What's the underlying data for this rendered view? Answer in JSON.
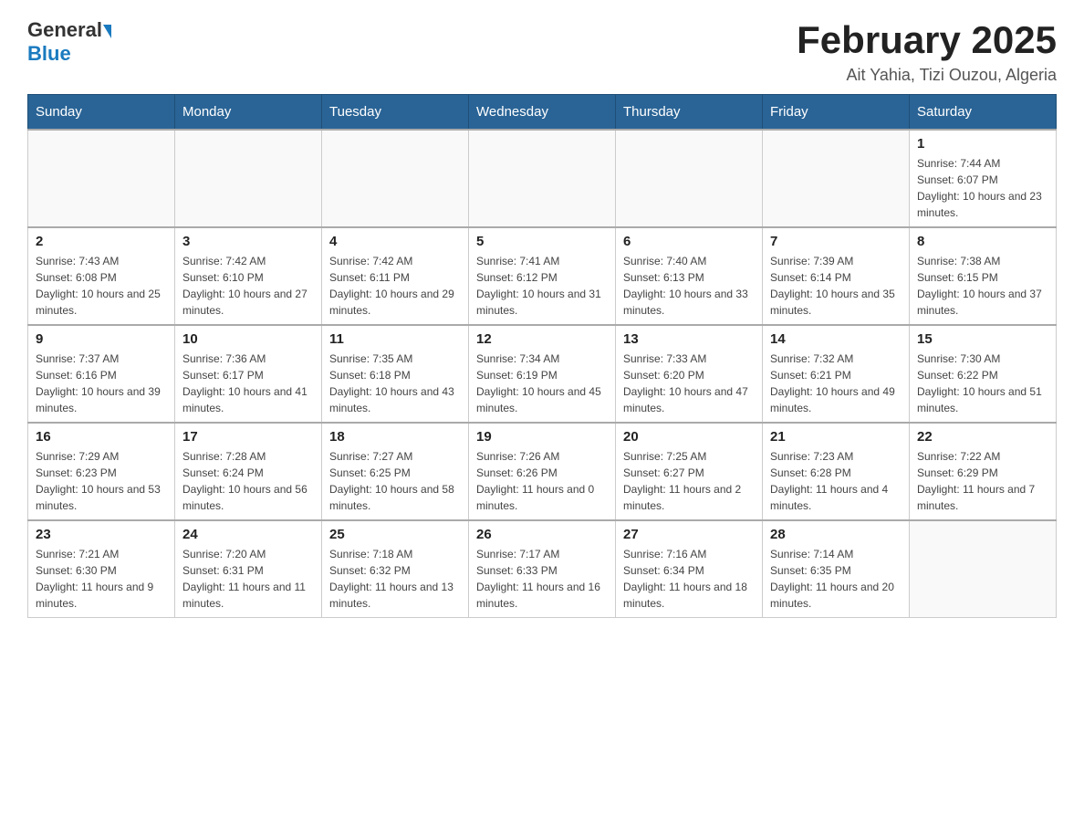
{
  "header": {
    "logo_general": "General",
    "logo_blue": "Blue",
    "month_title": "February 2025",
    "location": "Ait Yahia, Tizi Ouzou, Algeria"
  },
  "days_of_week": [
    "Sunday",
    "Monday",
    "Tuesday",
    "Wednesday",
    "Thursday",
    "Friday",
    "Saturday"
  ],
  "weeks": [
    [
      {
        "day": "",
        "info": ""
      },
      {
        "day": "",
        "info": ""
      },
      {
        "day": "",
        "info": ""
      },
      {
        "day": "",
        "info": ""
      },
      {
        "day": "",
        "info": ""
      },
      {
        "day": "",
        "info": ""
      },
      {
        "day": "1",
        "info": "Sunrise: 7:44 AM\nSunset: 6:07 PM\nDaylight: 10 hours and 23 minutes."
      }
    ],
    [
      {
        "day": "2",
        "info": "Sunrise: 7:43 AM\nSunset: 6:08 PM\nDaylight: 10 hours and 25 minutes."
      },
      {
        "day": "3",
        "info": "Sunrise: 7:42 AM\nSunset: 6:10 PM\nDaylight: 10 hours and 27 minutes."
      },
      {
        "day": "4",
        "info": "Sunrise: 7:42 AM\nSunset: 6:11 PM\nDaylight: 10 hours and 29 minutes."
      },
      {
        "day": "5",
        "info": "Sunrise: 7:41 AM\nSunset: 6:12 PM\nDaylight: 10 hours and 31 minutes."
      },
      {
        "day": "6",
        "info": "Sunrise: 7:40 AM\nSunset: 6:13 PM\nDaylight: 10 hours and 33 minutes."
      },
      {
        "day": "7",
        "info": "Sunrise: 7:39 AM\nSunset: 6:14 PM\nDaylight: 10 hours and 35 minutes."
      },
      {
        "day": "8",
        "info": "Sunrise: 7:38 AM\nSunset: 6:15 PM\nDaylight: 10 hours and 37 minutes."
      }
    ],
    [
      {
        "day": "9",
        "info": "Sunrise: 7:37 AM\nSunset: 6:16 PM\nDaylight: 10 hours and 39 minutes."
      },
      {
        "day": "10",
        "info": "Sunrise: 7:36 AM\nSunset: 6:17 PM\nDaylight: 10 hours and 41 minutes."
      },
      {
        "day": "11",
        "info": "Sunrise: 7:35 AM\nSunset: 6:18 PM\nDaylight: 10 hours and 43 minutes."
      },
      {
        "day": "12",
        "info": "Sunrise: 7:34 AM\nSunset: 6:19 PM\nDaylight: 10 hours and 45 minutes."
      },
      {
        "day": "13",
        "info": "Sunrise: 7:33 AM\nSunset: 6:20 PM\nDaylight: 10 hours and 47 minutes."
      },
      {
        "day": "14",
        "info": "Sunrise: 7:32 AM\nSunset: 6:21 PM\nDaylight: 10 hours and 49 minutes."
      },
      {
        "day": "15",
        "info": "Sunrise: 7:30 AM\nSunset: 6:22 PM\nDaylight: 10 hours and 51 minutes."
      }
    ],
    [
      {
        "day": "16",
        "info": "Sunrise: 7:29 AM\nSunset: 6:23 PM\nDaylight: 10 hours and 53 minutes."
      },
      {
        "day": "17",
        "info": "Sunrise: 7:28 AM\nSunset: 6:24 PM\nDaylight: 10 hours and 56 minutes."
      },
      {
        "day": "18",
        "info": "Sunrise: 7:27 AM\nSunset: 6:25 PM\nDaylight: 10 hours and 58 minutes."
      },
      {
        "day": "19",
        "info": "Sunrise: 7:26 AM\nSunset: 6:26 PM\nDaylight: 11 hours and 0 minutes."
      },
      {
        "day": "20",
        "info": "Sunrise: 7:25 AM\nSunset: 6:27 PM\nDaylight: 11 hours and 2 minutes."
      },
      {
        "day": "21",
        "info": "Sunrise: 7:23 AM\nSunset: 6:28 PM\nDaylight: 11 hours and 4 minutes."
      },
      {
        "day": "22",
        "info": "Sunrise: 7:22 AM\nSunset: 6:29 PM\nDaylight: 11 hours and 7 minutes."
      }
    ],
    [
      {
        "day": "23",
        "info": "Sunrise: 7:21 AM\nSunset: 6:30 PM\nDaylight: 11 hours and 9 minutes."
      },
      {
        "day": "24",
        "info": "Sunrise: 7:20 AM\nSunset: 6:31 PM\nDaylight: 11 hours and 11 minutes."
      },
      {
        "day": "25",
        "info": "Sunrise: 7:18 AM\nSunset: 6:32 PM\nDaylight: 11 hours and 13 minutes."
      },
      {
        "day": "26",
        "info": "Sunrise: 7:17 AM\nSunset: 6:33 PM\nDaylight: 11 hours and 16 minutes."
      },
      {
        "day": "27",
        "info": "Sunrise: 7:16 AM\nSunset: 6:34 PM\nDaylight: 11 hours and 18 minutes."
      },
      {
        "day": "28",
        "info": "Sunrise: 7:14 AM\nSunset: 6:35 PM\nDaylight: 11 hours and 20 minutes."
      },
      {
        "day": "",
        "info": ""
      }
    ]
  ]
}
